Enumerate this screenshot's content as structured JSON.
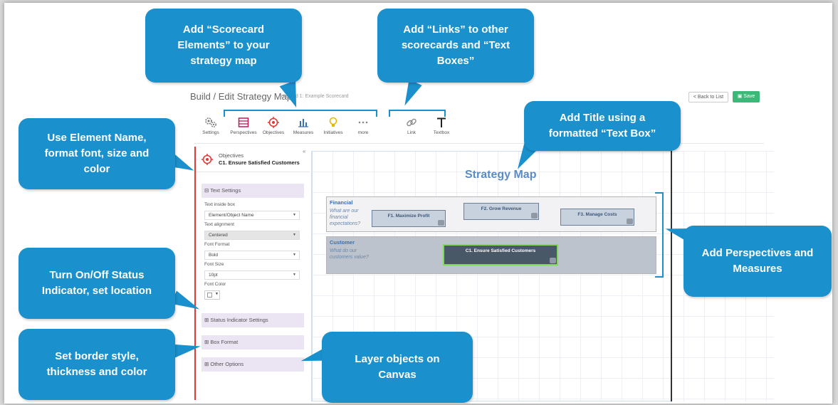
{
  "callouts": {
    "scorecard_elements": "Add “Scorecard Elements” to your strategy map",
    "links_textboxes": "Add “Links” to other scorecards and “Text Boxes”",
    "element_name": "Use Element Name, format font, size and color",
    "title_textbox": "Add Title using a formatted “Text Box”",
    "perspectives_measures": "Add Perspectives and Measures",
    "status_indicator": "Turn On/Off Status Indicator, set location",
    "border_style": "Set border style, thickness and color",
    "layer_objects": "Layer objects on Canvas"
  },
  "app": {
    "title": "Build / Edit Strategy Map",
    "crumb": "orecard 1: Example Scorecard",
    "back_label": "< Back to List",
    "save_label": "Save"
  },
  "toolbar": {
    "items": [
      {
        "label": "Settings",
        "icon": "gears-icon"
      },
      {
        "label": "Perspectives",
        "icon": "table-icon"
      },
      {
        "label": "Objectives",
        "icon": "crosshair-icon"
      },
      {
        "label": "Measures",
        "icon": "bar-chart-icon"
      },
      {
        "label": "Initiatives",
        "icon": "lightbulb-icon"
      },
      {
        "label": "more",
        "icon": "ellipsis-icon"
      },
      {
        "label": "Link",
        "icon": "link-icon"
      },
      {
        "label": "Textbox",
        "icon": "text-icon"
      }
    ]
  },
  "panel": {
    "kind": "Objectives",
    "name": "C1. Ensure Satisfied Customers",
    "collapse": "«",
    "text_settings": "Text Settings",
    "text_inside_label": "Text inside box",
    "text_inside_value": "Element/Object Name",
    "alignment_label": "Text alignment",
    "alignment_value": "Centered",
    "font_format_label": "Font Format",
    "font_format_value": "Bold",
    "font_size_label": "Font Size",
    "font_size_value": "10pt",
    "font_color_label": "Font Color",
    "status_settings": "Status Indicator Settings",
    "box_format": "Box Format",
    "other_options": "Other Options"
  },
  "canvas": {
    "title": "Strategy Map",
    "financial": {
      "name": "Financial",
      "question": "What are our financial expectations?",
      "objectives": [
        "F1. Maximize Profit",
        "F2. Grow Revenue",
        "F3. Manage Costs"
      ]
    },
    "customer": {
      "name": "Customer",
      "question": "What do our customers value?",
      "objectives": [
        "C1. Ensure Satisfied Customers"
      ]
    }
  },
  "colors": {
    "callout": "#1a90cc",
    "save_button": "#3cb878",
    "objective_selected_border": "#7ed957",
    "panel_accent": "#e53935"
  }
}
